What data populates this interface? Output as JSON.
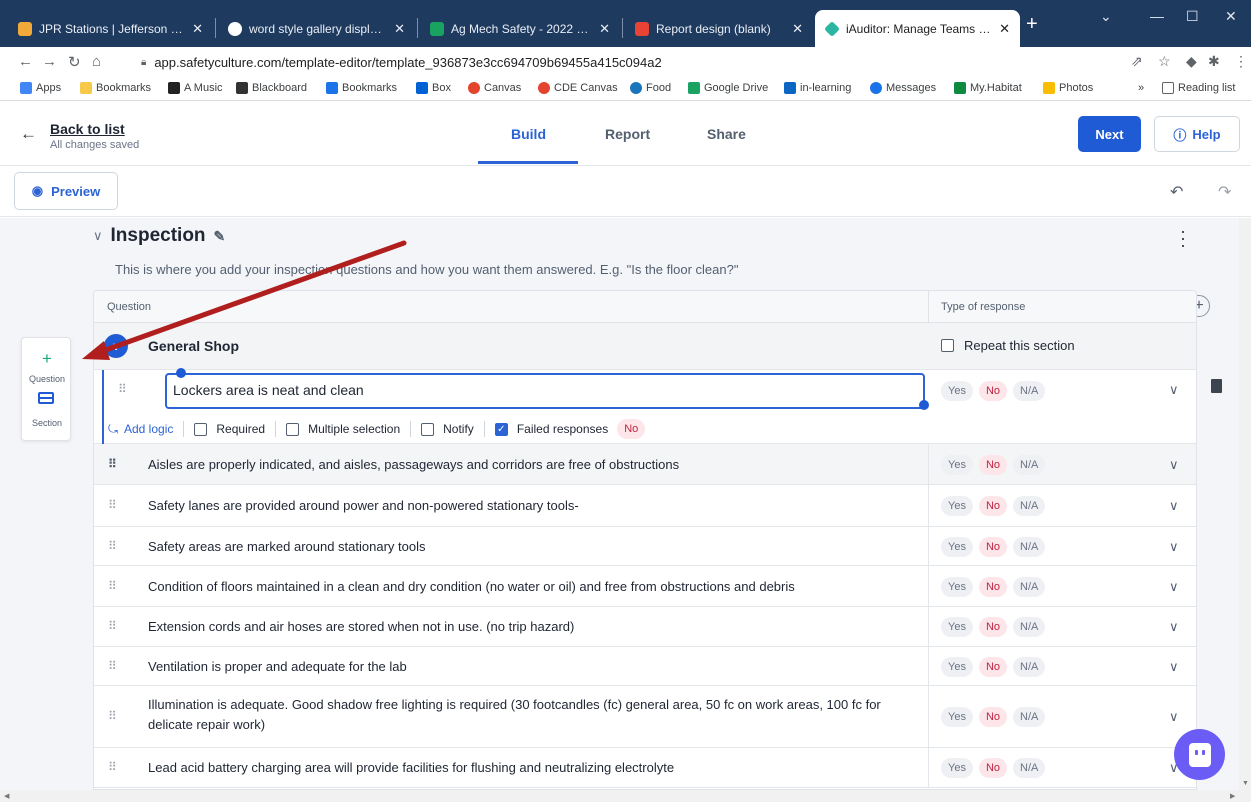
{
  "browser": {
    "tabs": [
      {
        "title": "JPR Stations | Jefferson Public",
        "color": "#f3a93a"
      },
      {
        "title": "word style gallery display size",
        "color": "#4285f4"
      },
      {
        "title": "Ag Mech Safety - 2022 - Goog",
        "color": "#1aa260"
      },
      {
        "title": "Report design (blank)",
        "color": "#e94335"
      },
      {
        "title": "iAuditor: Manage Teams and In",
        "color": "#2bb5a3"
      }
    ],
    "url": "app.safetyculture.com/template-editor/template_936873e3cc694709b69455a415c094a2",
    "bookmarks": [
      "Apps",
      "Bookmarks",
      "A Music",
      "Blackboard",
      "Bookmarks",
      "Box",
      "Canvas",
      "CDE Canvas",
      "Food",
      "Google Drive",
      "in-learning",
      "Messages",
      "My.Habitat",
      "Photos"
    ],
    "reading_list": "Reading list"
  },
  "header": {
    "back_label": "Back to list",
    "status": "All changes saved",
    "tabs": [
      "Build",
      "Report",
      "Share"
    ],
    "next_label": "Next",
    "help_label": "Help"
  },
  "toolbar": {
    "preview_label": "Preview"
  },
  "section": {
    "title": "Inspection",
    "description": "This is where you add your inspection questions and how you want them answered. E.g. \"Is the floor clean?\""
  },
  "table": {
    "col_question": "Question",
    "col_response": "Type of response",
    "group_label": "General Shop",
    "repeat_label": "Repeat this section",
    "selected_question": "Lockers area is neat and clean",
    "logic": {
      "add_logic": "Add logic",
      "required": "Required",
      "multiple": "Multiple selection",
      "notify": "Notify",
      "failed": "Failed responses",
      "failed_value": "No"
    },
    "response_options": {
      "yes": "Yes",
      "no": "No",
      "na": "N/A"
    },
    "questions": [
      "Aisles are properly indicated, and aisles, passageways and corridors are free of obstructions",
      "Safety lanes are provided around power and non-powered stationary tools-",
      "Safety areas are marked around stationary tools",
      "Condition of floors maintained in a clean and dry condition (no water or oil) and free from obstructions and debris",
      "Extension cords and air hoses are stored when not in use. (no trip hazard)",
      "Ventilation is proper and adequate for the lab",
      "Illumination is adequate. Good shadow free lighting is required (30 footcandles (fc) general area, 50 fc on work areas, 100 fc for delicate repair work)",
      "Lead acid battery charging area will provide facilities for flushing and neutralizing electrolyte"
    ]
  },
  "palette": {
    "question_label": "Question",
    "section_label": "Section"
  }
}
